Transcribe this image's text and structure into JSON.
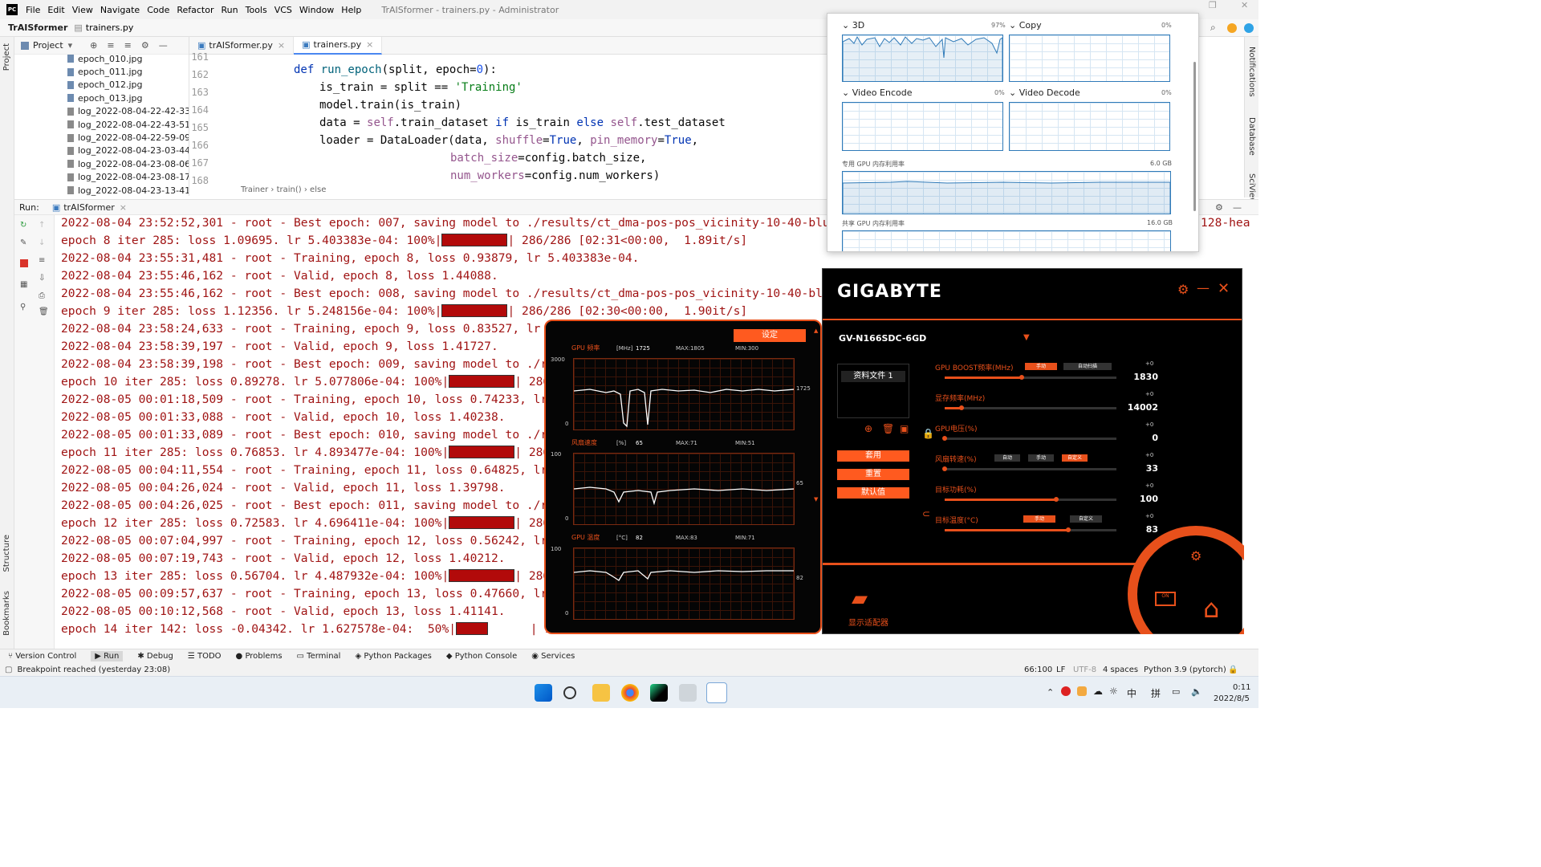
{
  "menu": {
    "items": [
      "File",
      "Edit",
      "View",
      "Navigate",
      "Code",
      "Refactor",
      "Run",
      "Tools",
      "VCS",
      "Window",
      "Help"
    ],
    "window_title": "TrAISformer - trainers.py - Administrator"
  },
  "nav": {
    "project": "TrAISformer",
    "file": "trainers.py"
  },
  "project_panel": {
    "title": "Project",
    "files": [
      "epoch_010.jpg",
      "epoch_011.jpg",
      "epoch_012.jpg",
      "epoch_013.jpg",
      "log_2022-08-04-22-42-33_As",
      "log_2022-08-04-22-43-51_As",
      "log_2022-08-04-22-59-09_As",
      "log_2022-08-04-23-03-44_As",
      "log_2022-08-04-23-08-06_As",
      "log_2022-08-04-23-08-17_As",
      "log_2022-08-04-23-13-41_As"
    ]
  },
  "editor": {
    "tabs": [
      "trAISformer.py",
      "trainers.py"
    ],
    "line_numbers": [
      "161",
      "162",
      "163",
      "164",
      "165",
      "166",
      "167",
      "168"
    ],
    "breadcrumbs": "Trainer  ›  train()  ›  else"
  },
  "run": {
    "label": "Run:",
    "config": "trAISformer"
  },
  "console": {
    "lines": [
      "2022-08-04 23:52:52,301 - root - Best epoch: 007, saving model to ./results/ct_dma-pos-pos_vicinity-10-40-blur-True-F",
      "epoch 8 iter 285: loss 1.09695. lr 5.403383e-04: 100%|",
      "2022-08-04 23:55:31,481 - root - Training, epoch 8, loss 0.93879, lr 5.403383e-04.",
      "2022-08-04 23:55:46,162 - root - Valid, epoch 8, loss 1.44088.",
      "2022-08-04 23:55:46,162 - root - Best epoch: 008, saving model to ./results/ct_dma-pos-pos_vicinity-10-40-blur-True-",
      "epoch 9 iter 285: loss 1.12356. lr 5.248156e-04: 100%|",
      "2022-08-04 23:58:24,633 - root - Training, epoch 9, loss 0.83527, lr 5.248",
      "2022-08-04 23:58:39,197 - root - Valid, epoch 9, loss 1.41727.",
      "2022-08-04 23:58:39,198 - root - Best epoch: 009, saving model to ./result",
      "epoch 10 iter 285: loss 0.89278. lr 5.077806e-04: 100%|",
      "2022-08-05 00:01:18,509 - root - Training, epoch 10, loss 0.74233, lr 5.07",
      "2022-08-05 00:01:33,088 - root - Valid, epoch 10, loss 1.40238.",
      "2022-08-05 00:01:33,089 - root - Best epoch: 010, saving model to ./result",
      "epoch 11 iter 285: loss 0.76853. lr 4.893477e-04: 100%|",
      "2022-08-05 00:04:11,554 - root - Training, epoch 11, loss 0.64825, lr 4.89",
      "2022-08-05 00:04:26,024 - root - Valid, epoch 11, loss 1.39798.",
      "2022-08-05 00:04:26,025 - root - Best epoch: 011, saving model to ./result",
      "epoch 12 iter 285: loss 0.72583. lr 4.696411e-04: 100%|",
      "2022-08-05 00:07:04,997 - root - Training, epoch 12, loss 0.56242, lr 4.69",
      "2022-08-05 00:07:19,743 - root - Valid, epoch 12, loss 1.40212.",
      "epoch 13 iter 285: loss 0.56704. lr 4.487932e-04: 100%|",
      "2022-08-05 00:09:57,637 - root - Training, epoch 13, loss 0.47660, lr 4.48",
      "2022-08-05 00:10:12,568 - root - Valid, epoch 13, loss 1.41141.",
      "epoch 14 iter 142: loss -0.04342. lr 1.627578e-04:  50%|"
    ],
    "tail_1": "128-hea",
    "tail_8": "| 286/286 [02:31<00:00,  1.89it/s]",
    "tail_9": "| 286/286 [02:30<00:00,  1.90it/s]",
    "tail_short": "| 286/286",
    "tail_last": "| 143/286"
  },
  "bottom_tabs": [
    "Version Control",
    "Run",
    "Debug",
    "TODO",
    "Problems",
    "Terminal",
    "Python Packages",
    "Python Console",
    "Services"
  ],
  "status": {
    "message": "Breakpoint reached (yesterday 23:08)",
    "position": "66:100",
    "line_sep": "LF",
    "encoding": "UTF-8",
    "indent": "4 spaces",
    "interpreter": "Python 3.9 (pytorch)"
  },
  "side_labels": {
    "project": "Project",
    "structure": "Structure",
    "bookmarks": "Bookmarks",
    "notifications": "Notifications",
    "database": "Database",
    "sciview": "SciView"
  },
  "taskmgr": {
    "g3d": "3D",
    "g3d_pct": "97%",
    "copy": "Copy",
    "copy_pct": "0%",
    "venc": "Video Encode",
    "venc_pct": "0%",
    "vdec": "Video Decode",
    "vdec_pct": "0%",
    "dedicated": "专用 GPU 内存利用率",
    "dedicated_max": "6.0 GB",
    "shared": "共享 GPU 内存利用率",
    "shared_max": "16.0 GB"
  },
  "gigabyte": {
    "brand": "GIGABYTE",
    "model": "GV-N166SDC-6GD",
    "profile": "资料文件 1",
    "apply": "套用",
    "reset": "重置",
    "default": "默认值",
    "display_adapter": "显示适配器",
    "settings_btn": "设定",
    "plots": [
      {
        "label": "GPU 频率",
        "unit": "[MHz]",
        "cur": "1725",
        "max": "MAX:1805",
        "min": "MIN:300",
        "top": "3000",
        "bottom": "0",
        "right": "1725"
      },
      {
        "label": "风扇速度",
        "unit": "[%]",
        "cur": "65",
        "max": "MAX:71",
        "min": "MIN:51",
        "top": "100",
        "bottom": "0",
        "right": "65"
      },
      {
        "label": "GPU 温度",
        "unit": "[°C]",
        "cur": "82",
        "max": "MAX:83",
        "min": "MIN:71",
        "top": "100",
        "bottom": "0",
        "right": "82"
      }
    ],
    "sliders": [
      {
        "label": "GPU BOOST频率(MHz)",
        "delta": "+0",
        "value": "1830",
        "pct": 0.45,
        "modes": [
          "手动",
          "自动扫描"
        ]
      },
      {
        "label": "显存频率(MHz)",
        "delta": "+0",
        "value": "14002",
        "pct": 0.1,
        "modes": []
      },
      {
        "label": "GPU电压(%)",
        "delta": "+0",
        "value": "0",
        "pct": 0.0,
        "modes": []
      },
      {
        "label": "风扇转速(%)",
        "delta": "+0",
        "value": "33",
        "pct": 0.0,
        "modes": [
          "自动",
          "手动",
          "自定义"
        ]
      },
      {
        "label": "目标功耗(%)",
        "delta": "+0",
        "value": "100",
        "pct": 0.65,
        "modes": []
      },
      {
        "label": "目标温度(°C)",
        "delta": "+0",
        "value": "83",
        "pct": 0.72,
        "modes": [
          "手动",
          "自定义"
        ]
      }
    ]
  },
  "clock": {
    "time": "0:11",
    "date": "2022/8/5"
  },
  "tray": {
    "ime": "中",
    "ime2": "拼"
  }
}
